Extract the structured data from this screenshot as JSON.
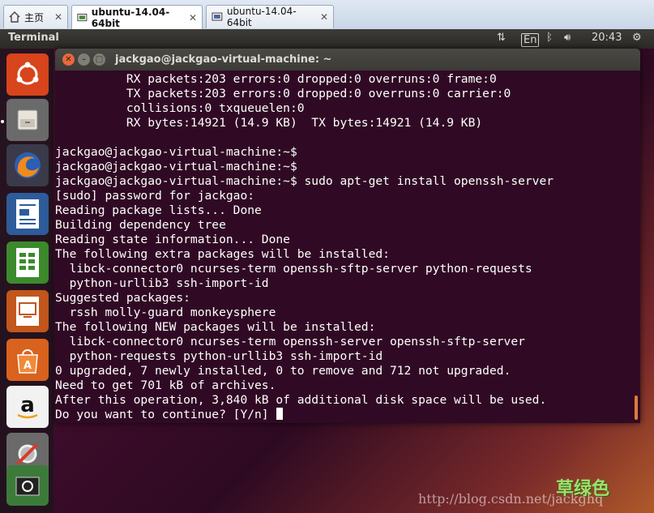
{
  "tabs": [
    {
      "label": "主页",
      "icon": "home-icon"
    },
    {
      "label": "ubuntu-14.04-64bit",
      "icon": "vm-icon"
    },
    {
      "label": "ubuntu-14.04-64bit",
      "icon": "vm-icon"
    }
  ],
  "panel": {
    "app_title": "Terminal",
    "keyboard": "En",
    "clock": "20:43"
  },
  "launcher": [
    "dash-icon",
    "files-icon",
    "firefox-icon",
    "writer-icon",
    "calc-icon",
    "impress-icon",
    "software-center-icon",
    "amazon-icon",
    "system-settings-icon",
    "workspace-switcher-icon"
  ],
  "window": {
    "title": "jackgao@jackgao-virtual-machine: ~"
  },
  "terminal": {
    "lines": [
      "          RX packets:203 errors:0 dropped:0 overruns:0 frame:0",
      "          TX packets:203 errors:0 dropped:0 overruns:0 carrier:0",
      "          collisions:0 txqueuelen:0",
      "          RX bytes:14921 (14.9 KB)  TX bytes:14921 (14.9 KB)",
      "",
      "jackgao@jackgao-virtual-machine:~$",
      "jackgao@jackgao-virtual-machine:~$",
      "jackgao@jackgao-virtual-machine:~$ sudo apt-get install openssh-server",
      "[sudo] password for jackgao:",
      "Reading package lists... Done",
      "Building dependency tree",
      "Reading state information... Done",
      "The following extra packages will be installed:",
      "  libck-connector0 ncurses-term openssh-sftp-server python-requests",
      "  python-urllib3 ssh-import-id",
      "Suggested packages:",
      "  rssh molly-guard monkeysphere",
      "The following NEW packages will be installed:",
      "  libck-connector0 ncurses-term openssh-server openssh-sftp-server",
      "  python-requests python-urllib3 ssh-import-id",
      "0 upgraded, 7 newly installed, 0 to remove and 712 not upgraded.",
      "Need to get 701 kB of archives.",
      "After this operation, 3,840 kB of additional disk space will be used.",
      "Do you want to continue? [Y/n] "
    ]
  },
  "watermark": {
    "url": "http://blog.csdn.net/jackghq",
    "logo": "草绿色"
  },
  "colors": {
    "terminal_bg": "#300a24",
    "terminal_fg": "#ffffff",
    "panel_bg": "#3c3b37"
  }
}
